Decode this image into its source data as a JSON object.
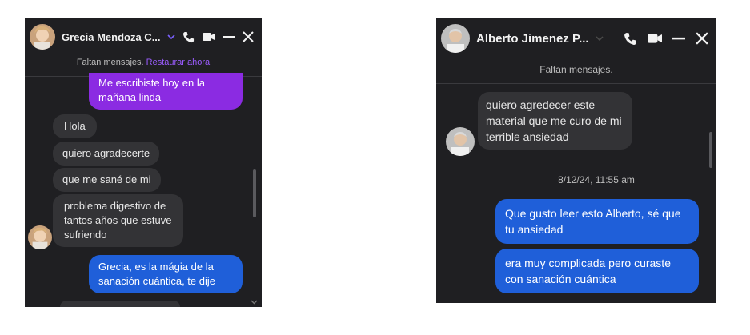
{
  "chat1": {
    "contact_name": "Grecia Mendoza C...",
    "notice_text": "Faltan mensajes.",
    "notice_action": "Restaurar ahora",
    "messages": [
      {
        "text": "Me escribiste hoy en la mañana linda"
      },
      {
        "text": "Hola"
      },
      {
        "text": "quiero agradecerte"
      },
      {
        "text": "que me sané de mi"
      },
      {
        "text": "problema digestivo de tantos años que estuve sufriendo"
      },
      {
        "text": "Grecia, es la mágia de la sanación cuántica, te dije"
      }
    ],
    "colors": {
      "accent": "#9b5cff",
      "outgoing_purple": "#8b2be2",
      "outgoing_blue": "#1f5fd9"
    }
  },
  "chat2": {
    "contact_name": "Alberto Jimenez P...",
    "notice_text": "Faltan mensajes.",
    "messages": [
      {
        "text": "quiero agredecer este material que me curo de mi terrible ansiedad"
      },
      {
        "text": "Que gusto leer esto Alberto, sé que tu ansiedad"
      },
      {
        "text": "era muy complicada pero curaste con sanación cuántica"
      }
    ],
    "timestamp": "8/12/24, 11:55 am"
  }
}
